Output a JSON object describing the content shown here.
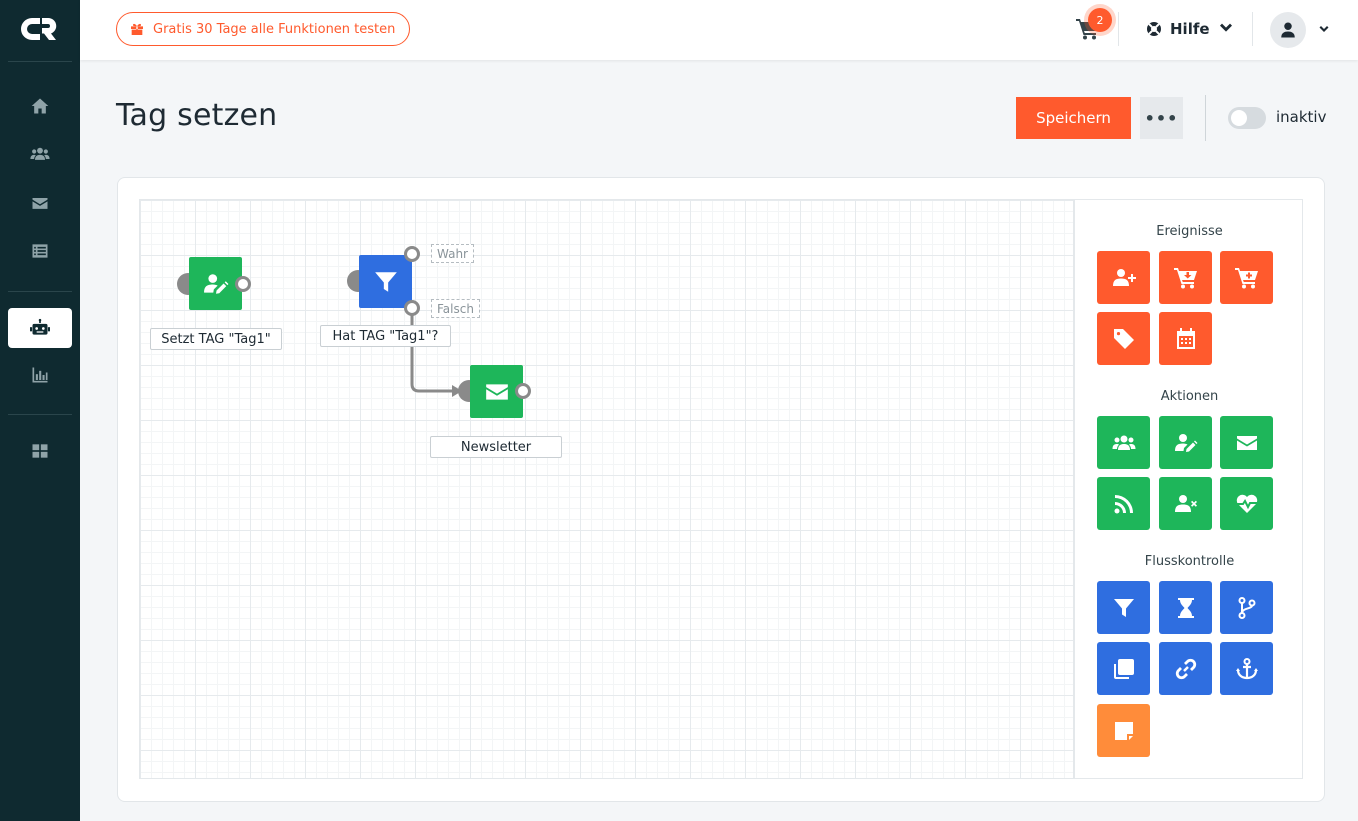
{
  "topbar": {
    "trial_label": "Gratis 30 Tage alle Funktionen testen",
    "cart_count": "2",
    "help_label": "Hilfe"
  },
  "sidebar": {
    "items": [
      "home-icon",
      "users-icon",
      "envelope-icon",
      "list-icon",
      "robot-icon",
      "chart-icon",
      "grid-icon"
    ],
    "active": "robot-icon"
  },
  "header": {
    "title": "Tag setzen",
    "save_label": "Speichern",
    "more_label": "•••",
    "status_label": "inaktiv"
  },
  "flow": {
    "nodes": [
      {
        "label": "Setzt TAG \"Tag1\"",
        "icon": "user-edit-icon",
        "color": "#1eb65a"
      },
      {
        "label": "Hat TAG \"Tag1\"?",
        "icon": "filter-icon",
        "color": "#2f6ee0"
      },
      {
        "label": "Newsletter",
        "icon": "envelope-icon",
        "color": "#1eb65a"
      }
    ],
    "branch_true": "Wahr",
    "branch_false": "Falsch"
  },
  "palette": {
    "events_title": "Ereignisse",
    "actions_title": "Aktionen",
    "flow_title": "Flusskontrolle",
    "events": [
      "user-plus-icon",
      "cart-arrow-icon",
      "cart-plus-icon",
      "tag-icon",
      "calendar-icon"
    ],
    "actions": [
      "users-icon",
      "user-edit-icon",
      "envelope-icon",
      "rss-icon",
      "user-remove-icon",
      "heartbeat-icon"
    ],
    "flow_control": [
      "filter-icon",
      "hourglass-icon",
      "branch-icon",
      "copy-icon",
      "link-icon",
      "anchor-icon",
      "note-icon"
    ]
  },
  "colors": {
    "accent": "#ff5a2d",
    "sidebar": "#0f2a30",
    "action": "#1eb65a",
    "flow": "#2f6ee0",
    "note": "#ff8c3a"
  }
}
